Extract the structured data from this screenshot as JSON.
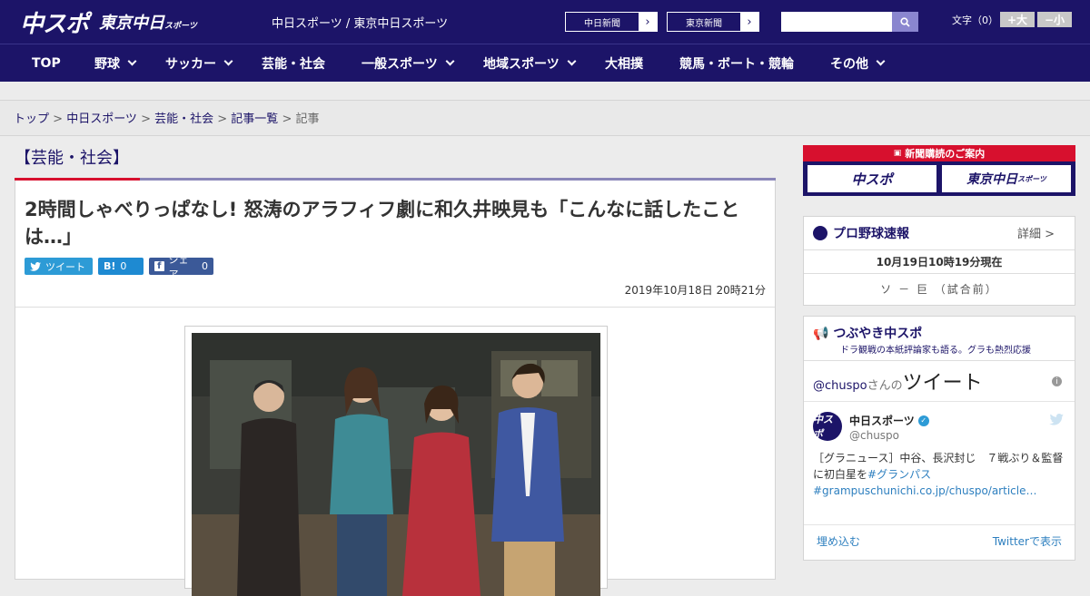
{
  "header": {
    "logo_main": "中スポ",
    "logo_tokyo": "東京中日",
    "logo_tokyo_sub": "スポーツ",
    "site_name": "中日スポーツ / 東京中日スポーツ",
    "btn_chunichi": "中日新聞",
    "btn_tokyo": "東京新聞",
    "search_placeholder": "",
    "font_label": "文字（0）",
    "font_up": "+大",
    "font_down": "−小"
  },
  "nav": [
    {
      "label": "TOP",
      "dropdown": false
    },
    {
      "label": "野球",
      "dropdown": true
    },
    {
      "label": "サッカー",
      "dropdown": true
    },
    {
      "label": "芸能・社会",
      "dropdown": false
    },
    {
      "label": "一般スポーツ",
      "dropdown": true
    },
    {
      "label": "地域スポーツ",
      "dropdown": true
    },
    {
      "label": "大相撲",
      "dropdown": false
    },
    {
      "label": "競馬・ボート・競輪",
      "dropdown": false
    },
    {
      "label": "その他",
      "dropdown": true
    }
  ],
  "breadcrumb": {
    "top": "トップ",
    "sep": " > ",
    "chunichi": "中日スポーツ",
    "geino": "芸能・社会",
    "list": "記事一覧",
    "current": "記事"
  },
  "category": "【芸能・社会】",
  "article": {
    "title": "2時間しゃべりっぱなし! 怒涛のアラフィフ劇に和久井映見も「こんなに話したことは…」",
    "tweet_label": "ツイート",
    "hatena_label": "B!",
    "hatena_count": "0",
    "share_label": "シェア",
    "share_count": "0",
    "date": "2019年10月18日 20時21分"
  },
  "sidebar": {
    "ad_header": "新聞購読のご案内",
    "ad_left": "中スポ",
    "ad_right": "東京中日",
    "ad_right_sub": "スポーツ",
    "baseball": {
      "title": "プロ野球速報",
      "more": "詳細 >",
      "updated": "10月19日10時19分現在",
      "game": "ソ － 巨 （試合前）"
    },
    "tweets": {
      "title": "つぶやき中スポ",
      "subtitle": "ドラ観戦の本紙評論家も語る。グラも熱烈応援",
      "handle_prefix": "@chuspo",
      "handle_suffix": "さんの",
      "heading": "ツイート",
      "info": "i",
      "avatar": "中スポ",
      "name": "中日スポーツ",
      "verified": "✓",
      "screen_name": "@chuspo",
      "text": "［グラニュース］中谷、長沢封じ　７戦ぶり＆監督に初白星を",
      "hashtag": "#グランパス",
      "link": "#grampuschunichi.co.jp/chuspo/article…",
      "embed": "埋め込む",
      "view": "Twitterで表示"
    }
  },
  "colors": {
    "brand": "#1c1468",
    "accent": "#d7102e"
  }
}
